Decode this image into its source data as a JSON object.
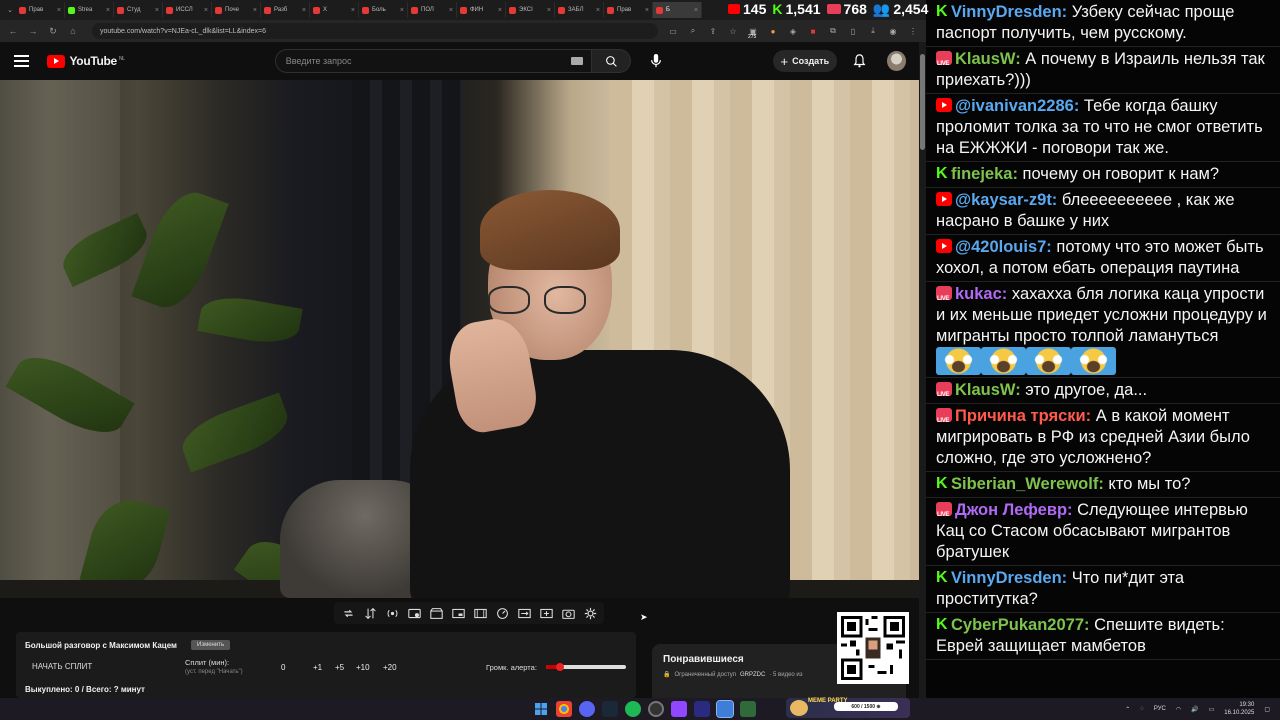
{
  "browser": {
    "tabs": [
      {
        "label": "Прав",
        "color": "#e53935"
      },
      {
        "label": "Strea",
        "color": "#53fc18"
      },
      {
        "label": "Студ",
        "color": "#e53935"
      },
      {
        "label": "ИССЛ",
        "color": "#e53935"
      },
      {
        "label": "Поче",
        "color": "#e53935"
      },
      {
        "label": "Разб",
        "color": "#e53935"
      },
      {
        "label": "Х",
        "color": "#e53935"
      },
      {
        "label": "Боль",
        "color": "#e53935"
      },
      {
        "label": "ПОЛ",
        "color": "#e53935"
      },
      {
        "label": "ФИН",
        "color": "#e53935"
      },
      {
        "label": "ЭКСІ",
        "color": "#e53935"
      },
      {
        "label": "ЗАБЛ",
        "color": "#e53935"
      },
      {
        "label": "Прав",
        "color": "#e53935"
      },
      {
        "label": "Б",
        "color": "#e53935"
      }
    ],
    "url": "youtube.com/watch?v=NJEa-cL_dlk&list=LL&index=6",
    "extension_badge": "275"
  },
  "stream_stats": {
    "youtube_viewers": "145",
    "kick_viewers": "1,541",
    "vk_viewers": "768",
    "total_viewers": "2,454"
  },
  "youtube": {
    "logo_text": "YouTube",
    "region": "NL",
    "search_placeholder": "Введите запрос",
    "create_label": "Создать"
  },
  "split_panel": {
    "title": "Большой разговор с Максимом Кацем",
    "badge": "Изменить",
    "start_button": "НАЧАТЬ СПЛИТ",
    "split_label": "Сплит (мин):",
    "split_sub": "(уст. перед \"Начать\")",
    "split_value": "0",
    "increments": [
      "+1",
      "+5",
      "+10",
      "+20"
    ],
    "volume_label": "Громк. алерта:",
    "volume_level": 0.18,
    "bought": "Выкуплено: 0 / Всего: ? минут"
  },
  "liked_panel": {
    "title": "Понравившиеся",
    "access": "Ограниченный доступ",
    "owner": "GRPZDC",
    "count": "· 5 видео из"
  },
  "chat": {
    "messages": [
      {
        "platform": "kick",
        "nick": "VinnyDresden:",
        "color": "#5aa9f0",
        "text": "Узбеку сейчас проще паспорт получить, чем русскому."
      },
      {
        "platform": "live",
        "nick": "KlausW:",
        "color": "#7ec34d",
        "text": "А почему в Израиль нельзя так приехать?)))"
      },
      {
        "platform": "yt",
        "nick": "@ivanivan2286:",
        "color": "#5aa9f0",
        "text": "Тебе когда башку проломит толка за то что не смог ответить на ЕЖЖЖИ - поговори так же."
      },
      {
        "platform": "kick",
        "nick": "finejeka:",
        "color": "#7ec34d",
        "text": "почему он говорит к нам?"
      },
      {
        "platform": "yt",
        "nick": "@kaysar-z9t:",
        "color": "#5aa9f0",
        "text": "блееееееееее , как же насрано в башке у них"
      },
      {
        "platform": "yt",
        "nick": "@420louis7:",
        "color": "#5aa9f0",
        "text": "потому что это может быть хохол, а потом ебать операция паутина"
      },
      {
        "platform": "live",
        "nick": "kukac:",
        "color": "#b06af5",
        "text": "хахахха бля логика каца упрости и их меньше приедет усложни процедуру и мигранты просто толпой ламануться",
        "emotes": 4
      },
      {
        "platform": "live",
        "nick": "KlausW:",
        "color": "#7ec34d",
        "text": "это другое, да..."
      },
      {
        "platform": "live",
        "nick": "Причина тряски:",
        "color": "#ff5a4a",
        "text": "А в какой момент мигрировать в РФ из средней Азии было сложно, где это усложнено?"
      },
      {
        "platform": "kick",
        "nick": "Siberian_Werewolf:",
        "color": "#7ec34d",
        "text": "кто мы то?"
      },
      {
        "platform": "live",
        "nick": "Джон Лефевр:",
        "color": "#b06af5",
        "text": "Следующее интервью Кац со Стасом обсасывают мигрантов братушек"
      },
      {
        "platform": "kick",
        "nick": "VinnyDresden:",
        "color": "#5aa9f0",
        "text": "Что пи*дит эта проститутка?"
      },
      {
        "platform": "kick",
        "nick": "CyberPukan2077:",
        "color": "#7ec34d",
        "text": "Спешите видеть: Еврей защищает мамбетов"
      }
    ]
  },
  "taskbar": {
    "meme_label": "MEME PARTY",
    "meme_progress": "600 / 1500 ⊕",
    "lang": "РУС",
    "time": "19:30",
    "date": "16.10.2025"
  }
}
